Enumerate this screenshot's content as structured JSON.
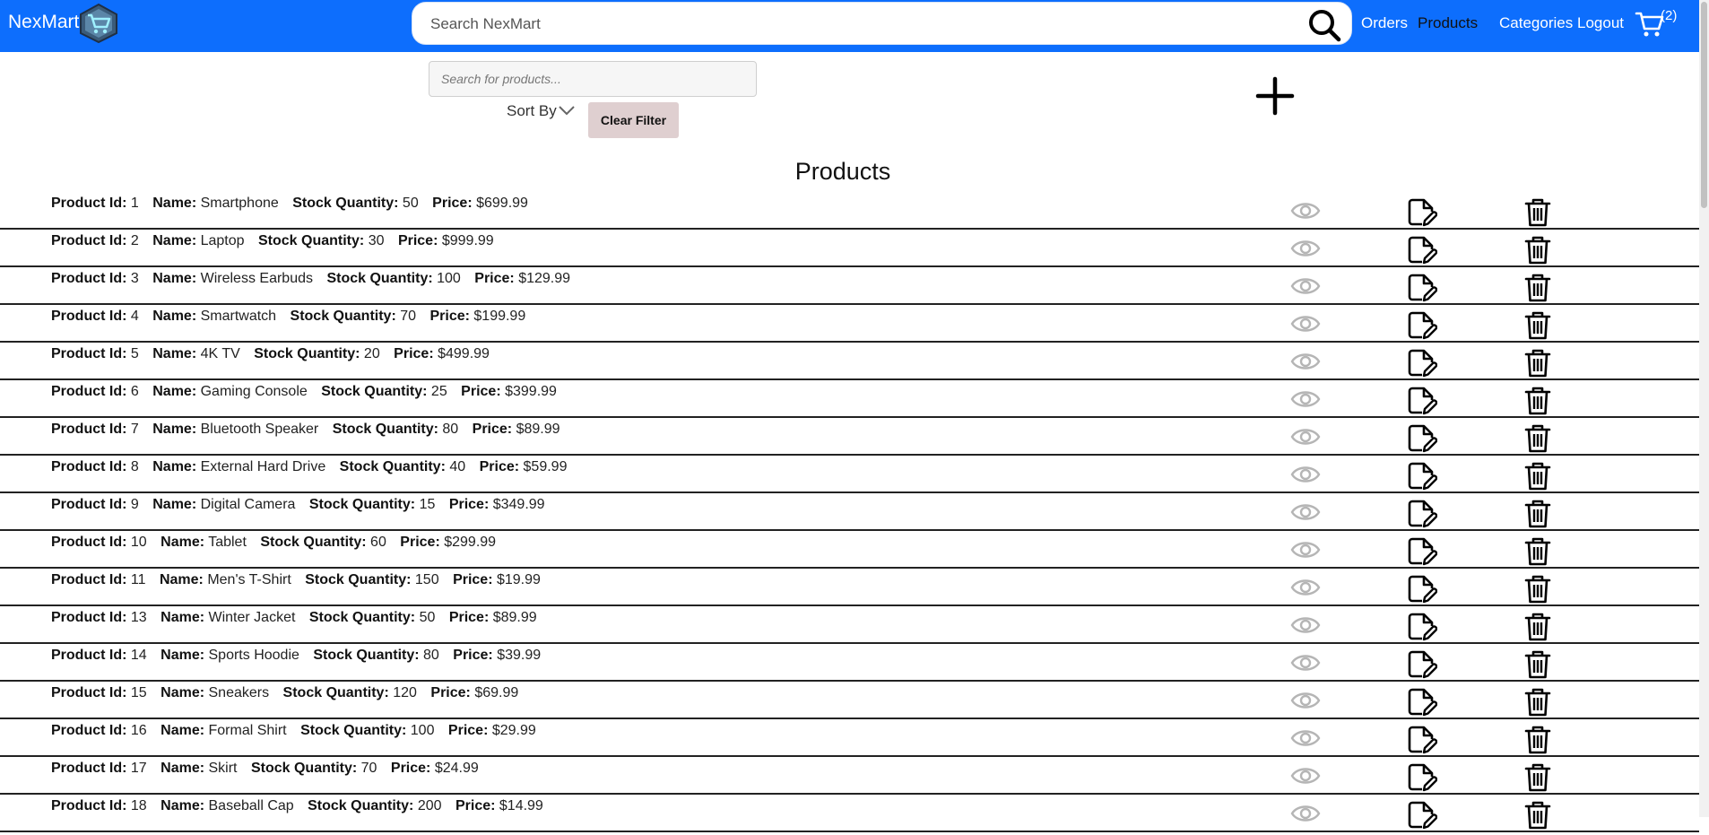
{
  "header": {
    "brand": "NexMart",
    "search_placeholder": "Search NexMart",
    "nav": [
      "Orders",
      "Products",
      "Categories",
      "Logout"
    ],
    "active_nav": "Products",
    "cart_count": "(2)"
  },
  "filters": {
    "search_placeholder": "Search for products...",
    "sort_label": "Sort By",
    "clear_label": "Clear Filter"
  },
  "page_title": "Products",
  "labels": {
    "id": "Product Id:",
    "name": "Name:",
    "stock": "Stock Quantity:",
    "price": "Price:"
  },
  "products": [
    {
      "id": "1",
      "name": "Smartphone",
      "stock": "50",
      "price": "$699.99"
    },
    {
      "id": "2",
      "name": "Laptop",
      "stock": "30",
      "price": "$999.99"
    },
    {
      "id": "3",
      "name": "Wireless Earbuds",
      "stock": "100",
      "price": "$129.99"
    },
    {
      "id": "4",
      "name": "Smartwatch",
      "stock": "70",
      "price": "$199.99"
    },
    {
      "id": "5",
      "name": "4K TV",
      "stock": "20",
      "price": "$499.99"
    },
    {
      "id": "6",
      "name": "Gaming Console",
      "stock": "25",
      "price": "$399.99"
    },
    {
      "id": "7",
      "name": "Bluetooth Speaker",
      "stock": "80",
      "price": "$89.99"
    },
    {
      "id": "8",
      "name": "External Hard Drive",
      "stock": "40",
      "price": "$59.99"
    },
    {
      "id": "9",
      "name": "Digital Camera",
      "stock": "15",
      "price": "$349.99"
    },
    {
      "id": "10",
      "name": "Tablet",
      "stock": "60",
      "price": "$299.99"
    },
    {
      "id": "11",
      "name": "Men's T-Shirt",
      "stock": "150",
      "price": "$19.99"
    },
    {
      "id": "13",
      "name": "Winter Jacket",
      "stock": "50",
      "price": "$89.99"
    },
    {
      "id": "14",
      "name": "Sports Hoodie",
      "stock": "80",
      "price": "$39.99"
    },
    {
      "id": "15",
      "name": "Sneakers",
      "stock": "120",
      "price": "$69.99"
    },
    {
      "id": "16",
      "name": "Formal Shirt",
      "stock": "100",
      "price": "$29.99"
    },
    {
      "id": "17",
      "name": "Skirt",
      "stock": "70",
      "price": "$24.99"
    },
    {
      "id": "18",
      "name": "Baseball Cap",
      "stock": "200",
      "price": "$14.99"
    }
  ],
  "icons": {
    "view": "eye-icon",
    "edit": "edit-icon",
    "delete": "trash-icon",
    "add": "plus-icon",
    "cart": "cart-icon",
    "search": "search-icon"
  },
  "colors": {
    "navbar": "#0d6efd",
    "clear_button": "#dfcfd0",
    "view_icon": "#b5b5b5"
  }
}
